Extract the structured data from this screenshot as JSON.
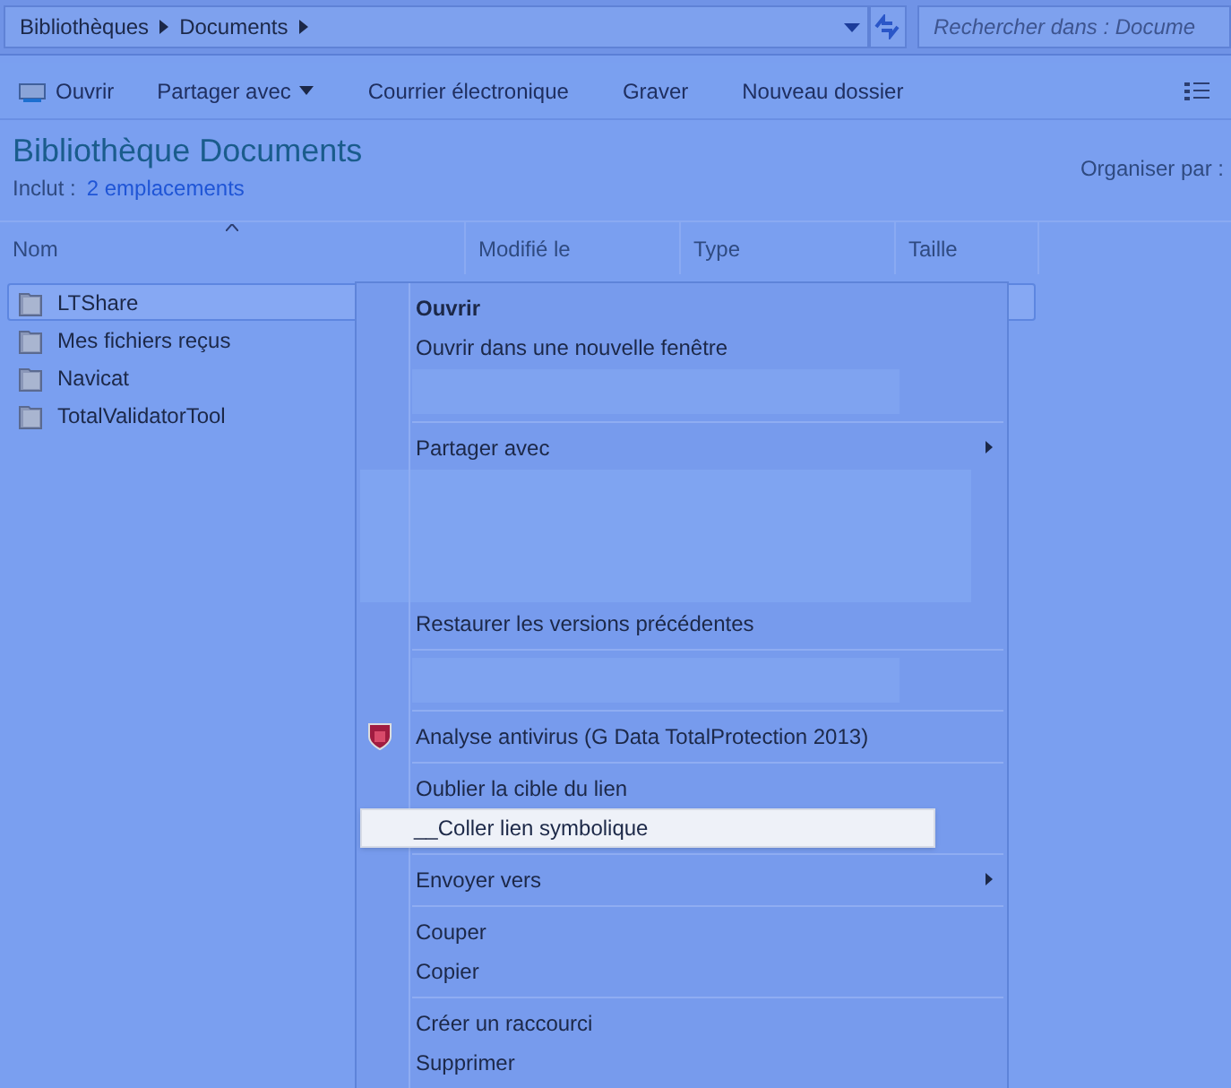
{
  "address_bar": {
    "crumbs": [
      "Bibliothèques",
      "Documents"
    ],
    "search_placeholder": "Rechercher dans : Docume"
  },
  "toolbar": [
    {
      "label": "Ouvrir",
      "kind": "open"
    },
    {
      "label": "Partager avec",
      "kind": "dropdown"
    },
    {
      "label": "Courrier électronique",
      "kind": "plain"
    },
    {
      "label": "Graver",
      "kind": "plain"
    },
    {
      "label": "Nouveau dossier",
      "kind": "plain"
    }
  ],
  "library": {
    "title": "Bibliothèque Documents",
    "include_label": "Inclut :",
    "include_link": "2 emplacements",
    "arrange_label": "Organiser par :"
  },
  "columns": [
    "Nom",
    "Modifié le",
    "Type",
    "Taille"
  ],
  "files": [
    {
      "name": "LTShare",
      "selected": true
    },
    {
      "name": "Mes fichiers reçus",
      "selected": false
    },
    {
      "name": "Navicat",
      "selected": false
    },
    {
      "name": "TotalValidatorTool",
      "selected": false
    }
  ],
  "context_menu": [
    {
      "kind": "item",
      "label": "Ouvrir",
      "bold": true
    },
    {
      "kind": "item",
      "label": "Ouvrir dans une nouvelle fenêtre"
    },
    {
      "kind": "gap"
    },
    {
      "kind": "separator"
    },
    {
      "kind": "item",
      "label": "Partager avec",
      "submenu": true
    },
    {
      "kind": "wide_gap"
    },
    {
      "kind": "item",
      "label": "Restaurer les versions précédentes"
    },
    {
      "kind": "separator"
    },
    {
      "kind": "gap"
    },
    {
      "kind": "separator"
    },
    {
      "kind": "icon_item",
      "label": "Analyse antivirus (G Data TotalProtection 2013)"
    },
    {
      "kind": "separator"
    },
    {
      "kind": "item",
      "label": "Oublier la cible du lien"
    },
    {
      "kind": "item",
      "label": "__Coller lien symbolique",
      "selected": true
    },
    {
      "kind": "separator"
    },
    {
      "kind": "item",
      "label": "Envoyer vers",
      "submenu": true
    },
    {
      "kind": "separator"
    },
    {
      "kind": "item",
      "label": "Couper"
    },
    {
      "kind": "item",
      "label": "Copier"
    },
    {
      "kind": "separator"
    },
    {
      "kind": "item",
      "label": "Créer un raccourci"
    },
    {
      "kind": "item",
      "label": "Supprimer"
    }
  ]
}
